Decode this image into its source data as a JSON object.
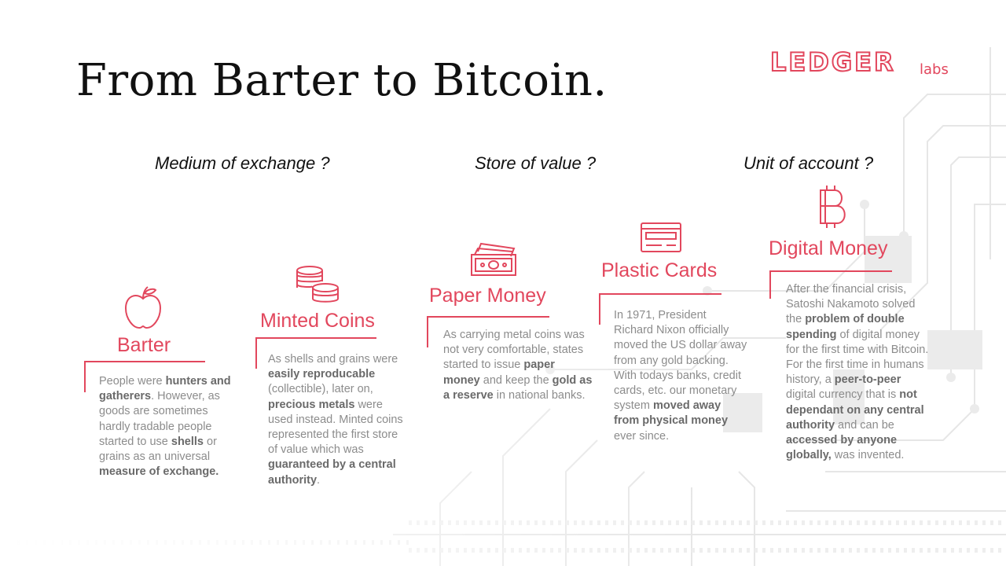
{
  "title": "From Barter to Bitcoin.",
  "logo": {
    "main": "LEDGER",
    "sub": "labs",
    "color": "#e2475d"
  },
  "accent_color": "#e2475d",
  "categories": [
    "Medium of exchange ?",
    "Store of value ?",
    "Unit of account ?"
  ],
  "stages": [
    {
      "title": "Barter",
      "icon": "apple-icon",
      "segments": [
        {
          "t": "People were ",
          "b": false
        },
        {
          "t": "hunters and gatherers",
          "b": true
        },
        {
          "t": ". However, as goods are sometimes hardly tradable people started to use ",
          "b": false
        },
        {
          "t": "shells",
          "b": true
        },
        {
          "t": " or grains as an universal ",
          "b": false
        },
        {
          "t": "measure of exchange.",
          "b": true
        }
      ]
    },
    {
      "title": "Minted Coins",
      "icon": "coins-icon",
      "segments": [
        {
          "t": "As shells and grains were ",
          "b": false
        },
        {
          "t": "easily reproducable",
          "b": true
        },
        {
          "t": " (collectible), later on, ",
          "b": false
        },
        {
          "t": "precious metals",
          "b": true
        },
        {
          "t": " were used instead. Minted coins represented the first store of value which was ",
          "b": false
        },
        {
          "t": "guaranteed by a central authority",
          "b": true
        },
        {
          "t": ".",
          "b": false
        }
      ]
    },
    {
      "title": "Paper Money",
      "icon": "banknote-icon",
      "segments": [
        {
          "t": "As carrying metal coins was not very comfortable, states started to issue ",
          "b": false
        },
        {
          "t": "paper money",
          "b": true
        },
        {
          "t": " and keep the ",
          "b": false
        },
        {
          "t": "gold as a reserve",
          "b": true
        },
        {
          "t": " in national banks.",
          "b": false
        }
      ]
    },
    {
      "title": "Plastic Cards",
      "icon": "credit-card-icon",
      "segments": [
        {
          "t": "In 1971, President Richard Nixon officially moved the US dollar away from any gold backing. With todays banks, credit cards, etc. our monetary system ",
          "b": false
        },
        {
          "t": "moved away from physical money",
          "b": true
        },
        {
          "t": " ever since.",
          "b": false
        }
      ]
    },
    {
      "title": "Digital Money",
      "icon": "bitcoin-icon",
      "segments": [
        {
          "t": "After the financial crisis, Satoshi Nakamoto solved the ",
          "b": false
        },
        {
          "t": "problem of double spending",
          "b": true
        },
        {
          "t": " of digital money for the first time with Bitcoin. For the first time in humans history, a ",
          "b": false
        },
        {
          "t": "peer-to-peer",
          "b": true
        },
        {
          "t": " digital currency that is ",
          "b": false
        },
        {
          "t": "not dependant on any central authority",
          "b": true
        },
        {
          "t": " and can be ",
          "b": false
        },
        {
          "t": "accessed by anyone globally,",
          "b": true
        },
        {
          "t": " was invented.",
          "b": false
        }
      ]
    }
  ]
}
